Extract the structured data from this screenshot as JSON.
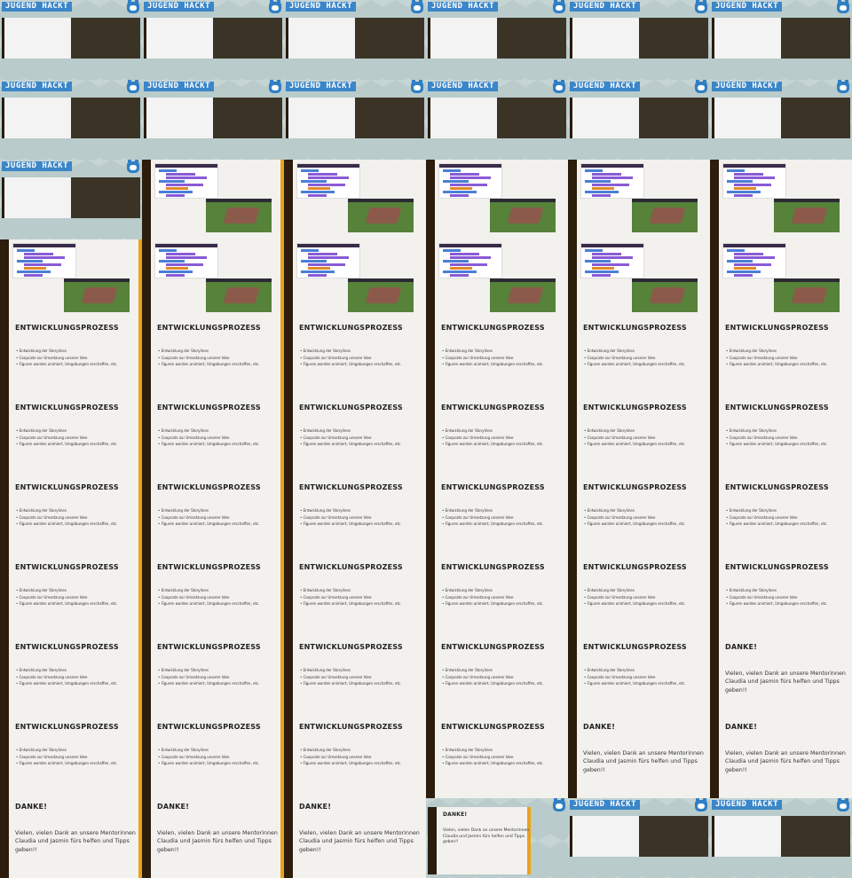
{
  "conference": {
    "logo_text": "JUGEND HACKT",
    "mascot": "owl-mascot-icon"
  },
  "slides": {
    "title": "ENTWICKLUNGSPROZESS",
    "bullets": [
      "Entwicklung der Storylines",
      "Coopcate zur Umsetzung unserer Idee",
      "Figuren worden animiert, Umgebungen erschaffen, etc."
    ],
    "thanks_title": "DANKE!",
    "thanks_text": "Vielen, vielen Dank an unsere Mentorinnen Claudia und Jasmin fürs helfen und Tipps geben!!"
  },
  "colors": {
    "background": "#aebfbf",
    "logo_blue": "#3a86c8",
    "slide_bg": "#f2f1ee",
    "slide_border": "#2c1d0d",
    "accent_orange": "#e9a21c"
  }
}
